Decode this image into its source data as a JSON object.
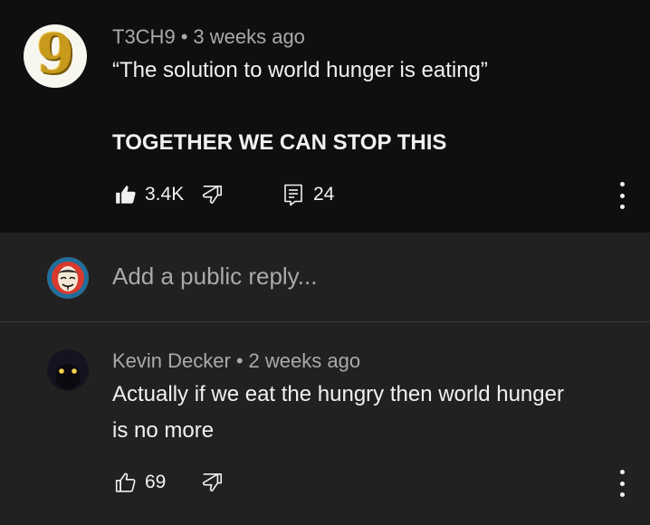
{
  "comment": {
    "author": "T3CH9",
    "separator": "•",
    "time": "3 weeks ago",
    "line1": "“The solution to world hunger is eating”",
    "line2": "TOGETHER WE CAN STOP THIS",
    "likes": "3.4K",
    "replies": "24",
    "avatar_text": "9"
  },
  "reply_input": {
    "placeholder": "Add a public reply..."
  },
  "reply": {
    "author": "Kevin Decker",
    "separator": "•",
    "time": "2 weeks ago",
    "line1": "Actually if we eat the hungry then world hunger",
    "line2": "is no more",
    "likes": "69"
  },
  "colors": {
    "top_background": "#0f0f0f",
    "background": "#212121",
    "primary_text": "#f1f1f1",
    "secondary_text": "#aaaaaa",
    "avatar_gold": "#c79a1c"
  },
  "icons": {
    "like_filled": "thumbs-up-filled-icon",
    "like_outline": "thumbs-up-outline-icon",
    "dislike": "thumbs-down-outline-icon",
    "reply": "comment-icon",
    "more": "kebab-menu-icon"
  }
}
